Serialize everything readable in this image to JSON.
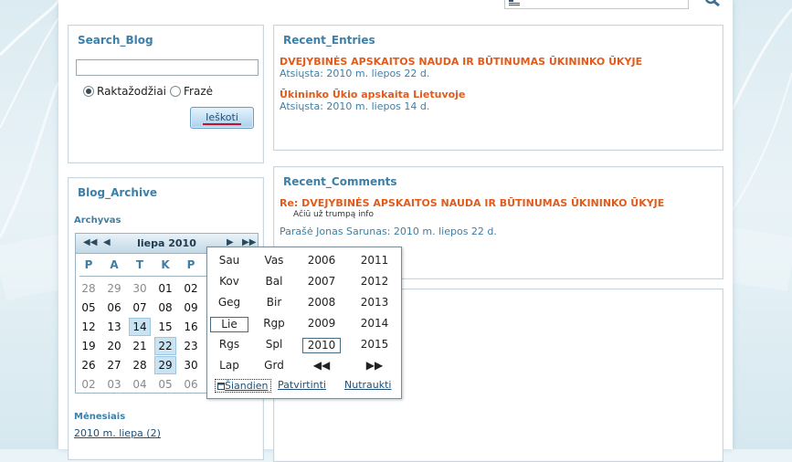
{
  "search_blog": {
    "title": "Search_Blog",
    "input_value": "",
    "radio_keywords": "Raktažodžiai",
    "radio_phrase": "Frazė",
    "button": "Ieškoti"
  },
  "recent_entries": {
    "title": "Recent_Entries",
    "items": [
      {
        "title": "DVEJYBINĖS APSKAITOS NAUDA IR BŪTINUMAS ŪKININKO ŪKYJE",
        "meta": "Atsiųsta: 2010 m. liepos 22 d."
      },
      {
        "title": "Ūkininko Ūkio apskaita Lietuvoje",
        "meta": "Atsiųsta: 2010 m. liepos 14 d."
      }
    ]
  },
  "recent_comments": {
    "title": "Recent_Comments",
    "items": [
      {
        "title": "Re: DVEJYBINĖS APSKAITOS NAUDA IR BŪTINUMAS ŪKININKO ŪKYJE",
        "body": "Ačiū už trumpą info",
        "meta": "Parašė Jonas Sarunas: 2010 m. liepos 22 d."
      }
    ]
  },
  "blog_archive": {
    "title": "Blog_Archive",
    "archive_label": "Archyvas",
    "months_label": "Mėnesiais",
    "months_link": "2010 m. liepa (2)",
    "calendar": {
      "title": "liepa 2010",
      "nav_prev_year": "◀◀",
      "nav_prev_month": "◀",
      "nav_next_month": "▶",
      "nav_next_year": "▶▶",
      "dow": [
        "P",
        "A",
        "T",
        "K",
        "P"
      ],
      "weeks": [
        [
          "28",
          "29",
          "30",
          "01",
          "02"
        ],
        [
          "05",
          "06",
          "07",
          "08",
          "09"
        ],
        [
          "12",
          "13",
          "14",
          "15",
          "16"
        ],
        [
          "19",
          "20",
          "21",
          "22",
          "23"
        ],
        [
          "26",
          "27",
          "28",
          "29",
          "30"
        ],
        [
          "02",
          "03",
          "04",
          "05",
          "06"
        ]
      ]
    }
  },
  "month_year_popup": {
    "months_left": [
      "Sau",
      "Kov",
      "Geg",
      "Lie",
      "Rgs",
      "Lap"
    ],
    "months_right": [
      "Vas",
      "Bal",
      "Bir",
      "Rgp",
      "Spl",
      "Grd"
    ],
    "years_left": [
      "2006",
      "2007",
      "2008",
      "2009",
      "2010"
    ],
    "years_right": [
      "2011",
      "2012",
      "2013",
      "2014",
      "2015"
    ],
    "prev_years": "◀◀",
    "next_years": "▶▶",
    "today": "Šiandien",
    "confirm": "Patvirtinti",
    "cancel": "Nutraukti"
  },
  "colors": {
    "title_blue": "#3d7fa6",
    "entry_orange": "#e15b1d",
    "link_blue": "#1d4f78",
    "highlight": "#c9e3f3"
  }
}
